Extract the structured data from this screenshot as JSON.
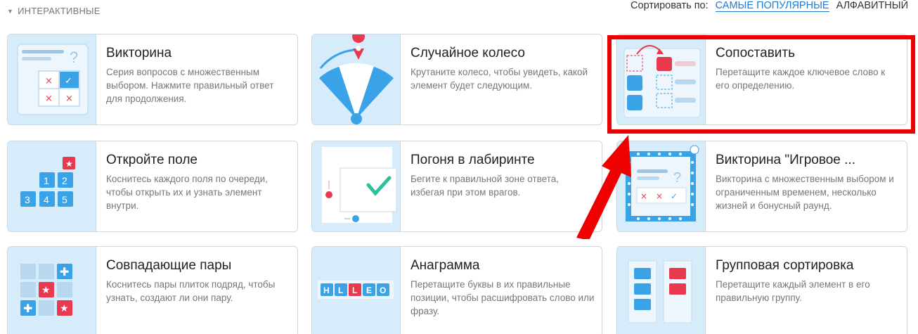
{
  "section": {
    "label": "ИНТЕРАКТИВНЫЕ"
  },
  "sort": {
    "label": "Сортировать по:",
    "options": [
      "САМЫЕ ПОПУЛЯРНЫЕ",
      "АЛФАВИТНЫЙ"
    ],
    "selected": "САМЫЕ ПОПУЛЯРНЫЕ"
  },
  "cards": [
    {
      "title": "Викторина",
      "desc": "Серия вопросов с множественным выбором. Нажмите правильный ответ для продолжения."
    },
    {
      "title": "Случайное колесо",
      "desc": "Крутаните колесо, чтобы увидеть, какой элемент будет следующим."
    },
    {
      "title": "Сопоставить",
      "desc": "Перетащите каждое ключевое слово к его определению."
    },
    {
      "title": "Откройте поле",
      "desc": "Коснитесь каждого поля по очереди, чтобы открыть их и узнать элемент внутри."
    },
    {
      "title": "Погоня в лабиринте",
      "desc": "Бегите к правильной зоне ответа, избегая при этом врагов."
    },
    {
      "title": "Викторина \"Игровое ...",
      "desc": "Викторина с множественным выбором и ограниченным временем, несколько жизней и бонусный раунд."
    },
    {
      "title": "Совпадающие пары",
      "desc": "Коснитесь пары плиток подряд, чтобы узнать, создают ли они пару."
    },
    {
      "title": "Анаграмма",
      "desc": "Перетащите буквы в их правильные позиции, чтобы расшифровать слово или фразу."
    },
    {
      "title": "Групповая сортировка",
      "desc": "Перетащите каждый элемент в его правильную группу."
    }
  ],
  "thumb_text": {
    "box_numbers": [
      "1",
      "2",
      "3",
      "4",
      "5"
    ],
    "anagram_letters": [
      "H",
      "L",
      "L",
      "E",
      "O"
    ],
    "question_mark": "?"
  },
  "colors": {
    "accent": "#1e7bd1",
    "thumb_bg": "#d6ecfb",
    "tile_blue": "#3aa3e8",
    "tile_red": "#e8394e",
    "highlight": "#ee0000"
  }
}
